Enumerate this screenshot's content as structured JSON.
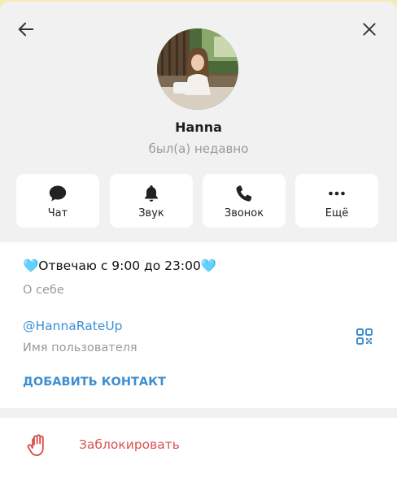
{
  "header": {
    "back_icon": "arrow-left-icon",
    "close_icon": "close-icon"
  },
  "profile": {
    "name": "Hanna",
    "status": "был(а) недавно"
  },
  "actions": [
    {
      "label": "Чат",
      "icon": "chat-bubble-icon"
    },
    {
      "label": "Звук",
      "icon": "bell-icon"
    },
    {
      "label": "Звонок",
      "icon": "phone-icon"
    },
    {
      "label": "Ещё",
      "icon": "more-dots-icon"
    }
  ],
  "info": {
    "bio": "🩵Отвечаю с 9:00 до 23:00🩵",
    "bio_caption": "О себе",
    "username": "@HannaRateUp",
    "username_caption": "Имя пользователя",
    "add_contact": "ДОБАВИТЬ КОНТАКТ",
    "qr_icon": "qr-code-icon"
  },
  "block": {
    "label": "Заблокировать",
    "icon": "hand-stop-icon"
  },
  "colors": {
    "accent": "#3d8fd1",
    "danger": "#d9534f",
    "muted": "#9a9a9a",
    "panel_bg": "#f1f1f1"
  }
}
